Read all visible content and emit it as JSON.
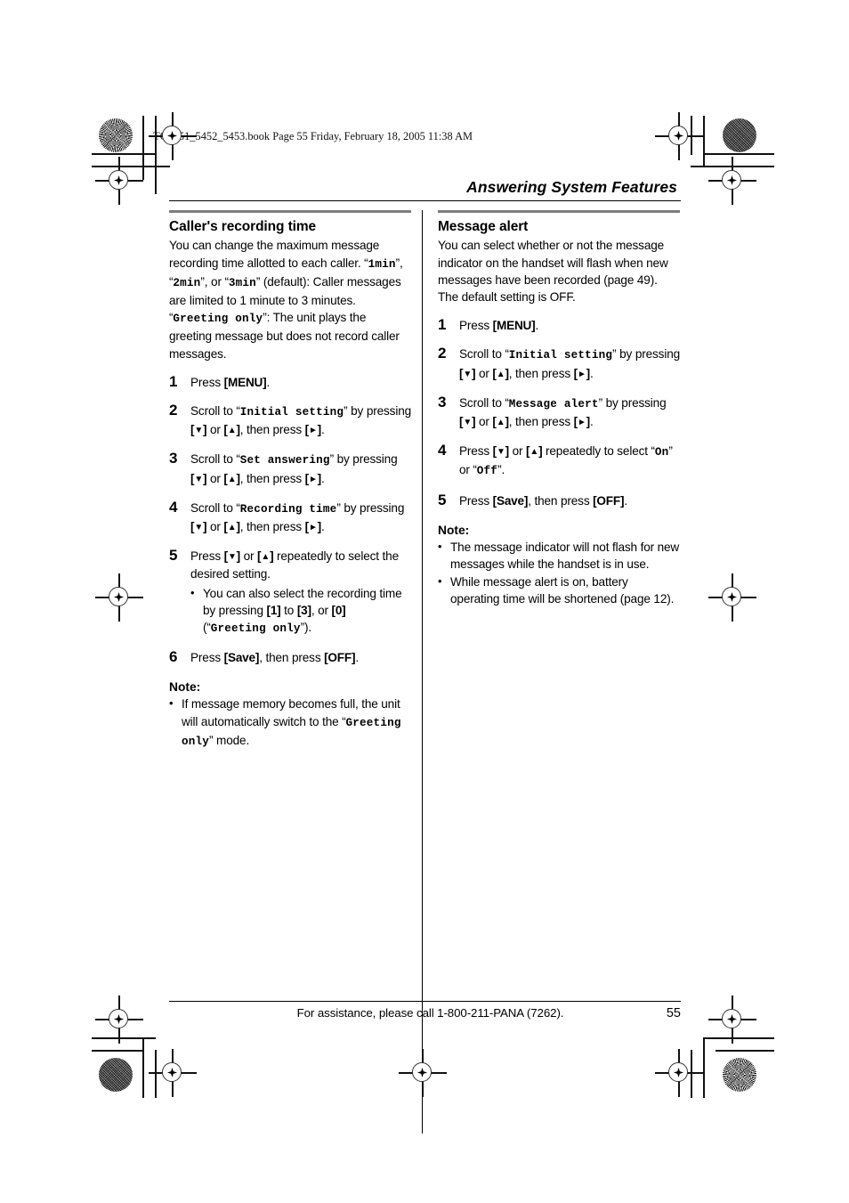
{
  "file_header": "TG5451_5452_5453.book  Page 55  Friday, February 18, 2005  11:38 AM",
  "section_title": "Answering System Features",
  "left_column": {
    "heading": "Caller's recording time",
    "intro_1_a": "You can change the maximum message recording time allotted to each caller. “",
    "intro_1_code1": "1min",
    "intro_1_b": "”, “",
    "intro_1_code2": "2min",
    "intro_1_c": "”, or “",
    "intro_1_code3": "3min",
    "intro_1_d": "” (default): Caller messages are limited to 1 minute to 3 minutes.",
    "intro_2_a": "“",
    "intro_2_code": "Greeting only",
    "intro_2_b": "”: The unit plays the greeting message but does not record caller messages.",
    "steps": [
      {
        "num": "1",
        "parts": [
          {
            "t": "text",
            "v": "Press "
          },
          {
            "t": "key",
            "v": "MENU"
          },
          {
            "t": "text",
            "v": "."
          }
        ]
      },
      {
        "num": "2",
        "parts": [
          {
            "t": "text",
            "v": "Scroll to “"
          },
          {
            "t": "code",
            "v": "Initial setting"
          },
          {
            "t": "text",
            "v": "” by pressing "
          },
          {
            "t": "keydown",
            "v": ""
          },
          {
            "t": "text",
            "v": " or "
          },
          {
            "t": "keyup",
            "v": ""
          },
          {
            "t": "text",
            "v": ", then press "
          },
          {
            "t": "keyright",
            "v": ""
          },
          {
            "t": "text",
            "v": "."
          }
        ]
      },
      {
        "num": "3",
        "parts": [
          {
            "t": "text",
            "v": "Scroll to “"
          },
          {
            "t": "code",
            "v": "Set answering"
          },
          {
            "t": "text",
            "v": "” by pressing "
          },
          {
            "t": "keydown",
            "v": ""
          },
          {
            "t": "text",
            "v": " or "
          },
          {
            "t": "keyup",
            "v": ""
          },
          {
            "t": "text",
            "v": ", then press "
          },
          {
            "t": "keyright",
            "v": ""
          },
          {
            "t": "text",
            "v": "."
          }
        ]
      },
      {
        "num": "4",
        "parts": [
          {
            "t": "text",
            "v": "Scroll to “"
          },
          {
            "t": "code",
            "v": "Recording time"
          },
          {
            "t": "text",
            "v": "” by pressing "
          },
          {
            "t": "keydown",
            "v": ""
          },
          {
            "t": "text",
            "v": " or "
          },
          {
            "t": "keyup",
            "v": ""
          },
          {
            "t": "text",
            "v": ", then press "
          },
          {
            "t": "keyright",
            "v": ""
          },
          {
            "t": "text",
            "v": "."
          }
        ]
      },
      {
        "num": "5",
        "parts": [
          {
            "t": "text",
            "v": "Press "
          },
          {
            "t": "keydown",
            "v": ""
          },
          {
            "t": "text",
            "v": " or "
          },
          {
            "t": "keyup",
            "v": ""
          },
          {
            "t": "text",
            "v": " repeatedly to select the desired setting."
          }
        ],
        "sub": [
          [
            {
              "t": "text",
              "v": "You can also select the recording time by pressing "
            },
            {
              "t": "key",
              "v": "1"
            },
            {
              "t": "text",
              "v": " to "
            },
            {
              "t": "key",
              "v": "3"
            },
            {
              "t": "text",
              "v": ", or "
            },
            {
              "t": "key",
              "v": "0"
            },
            {
              "t": "text",
              "v": " (“"
            },
            {
              "t": "code",
              "v": "Greeting only"
            },
            {
              "t": "text",
              "v": "”)."
            }
          ]
        ]
      },
      {
        "num": "6",
        "parts": [
          {
            "t": "text",
            "v": "Press "
          },
          {
            "t": "key",
            "v": "Save"
          },
          {
            "t": "text",
            "v": ", then press "
          },
          {
            "t": "key",
            "v": "OFF"
          },
          {
            "t": "text",
            "v": "."
          }
        ]
      }
    ],
    "note_label": "Note:",
    "notes": [
      [
        {
          "t": "text",
          "v": "If message memory becomes full, the unit will automatically switch to the “"
        },
        {
          "t": "code",
          "v": "Greeting only"
        },
        {
          "t": "text",
          "v": "” mode."
        }
      ]
    ]
  },
  "right_column": {
    "heading": "Message alert",
    "intro": "You can select whether or not the message indicator on the handset will flash when new messages have been recorded (page 49). The default setting is OFF.",
    "steps": [
      {
        "num": "1",
        "parts": [
          {
            "t": "text",
            "v": "Press "
          },
          {
            "t": "key",
            "v": "MENU"
          },
          {
            "t": "text",
            "v": "."
          }
        ]
      },
      {
        "num": "2",
        "parts": [
          {
            "t": "text",
            "v": "Scroll to “"
          },
          {
            "t": "code",
            "v": "Initial setting"
          },
          {
            "t": "text",
            "v": "” by pressing "
          },
          {
            "t": "keydown",
            "v": ""
          },
          {
            "t": "text",
            "v": " or "
          },
          {
            "t": "keyup",
            "v": ""
          },
          {
            "t": "text",
            "v": ", then press "
          },
          {
            "t": "keyright",
            "v": ""
          },
          {
            "t": "text",
            "v": "."
          }
        ]
      },
      {
        "num": "3",
        "parts": [
          {
            "t": "text",
            "v": "Scroll to “"
          },
          {
            "t": "code",
            "v": "Message alert"
          },
          {
            "t": "text",
            "v": "” by pressing "
          },
          {
            "t": "keydown",
            "v": ""
          },
          {
            "t": "text",
            "v": " or "
          },
          {
            "t": "keyup",
            "v": ""
          },
          {
            "t": "text",
            "v": ", then press "
          },
          {
            "t": "keyright",
            "v": ""
          },
          {
            "t": "text",
            "v": "."
          }
        ]
      },
      {
        "num": "4",
        "parts": [
          {
            "t": "text",
            "v": "Press "
          },
          {
            "t": "keydown",
            "v": ""
          },
          {
            "t": "text",
            "v": " or "
          },
          {
            "t": "keyup",
            "v": ""
          },
          {
            "t": "text",
            "v": " repeatedly to select “"
          },
          {
            "t": "code",
            "v": "On"
          },
          {
            "t": "text",
            "v": "” or “"
          },
          {
            "t": "code",
            "v": "Off"
          },
          {
            "t": "text",
            "v": "”."
          }
        ]
      },
      {
        "num": "5",
        "parts": [
          {
            "t": "text",
            "v": "Press "
          },
          {
            "t": "key",
            "v": "Save"
          },
          {
            "t": "text",
            "v": ", then press "
          },
          {
            "t": "key",
            "v": "OFF"
          },
          {
            "t": "text",
            "v": "."
          }
        ]
      }
    ],
    "note_label": "Note:",
    "notes": [
      [
        {
          "t": "text",
          "v": "The message indicator will not flash for new messages while the handset is in use."
        }
      ],
      [
        {
          "t": "text",
          "v": "While message alert is on, battery operating time will be shortened (page 12)."
        }
      ]
    ]
  },
  "footer": {
    "assistance": "For assistance, please call 1-800-211-PANA (7262).",
    "page_number": "55"
  },
  "colors": {
    "rule_gray": "#7d7d7d",
    "text": "#000000"
  }
}
